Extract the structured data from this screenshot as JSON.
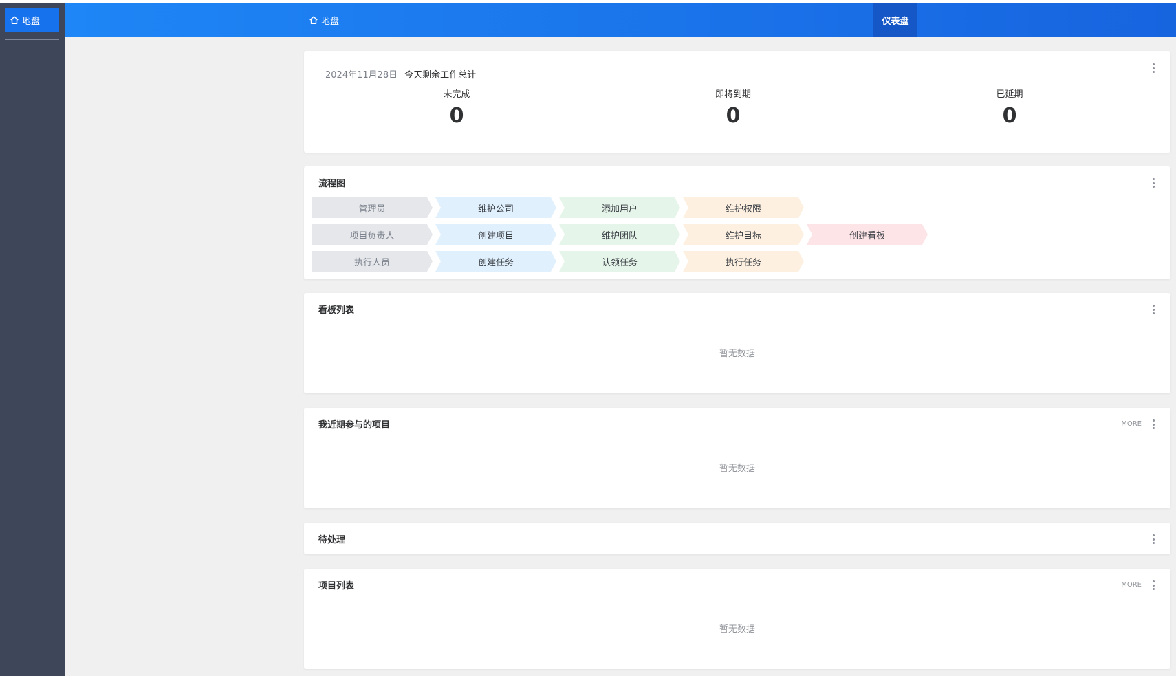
{
  "sidebar": {
    "logo_label": "地盘"
  },
  "header": {
    "breadcrumb": "地盘",
    "active_tab": "仪表盘"
  },
  "summary": {
    "date": "2024年11月28日",
    "title": "今天剩余工作总计",
    "stats": [
      {
        "label": "未完成",
        "value": "0"
      },
      {
        "label": "即将到期",
        "value": "0"
      },
      {
        "label": "已延期",
        "value": "0"
      }
    ]
  },
  "flow": {
    "title": "流程图",
    "rows": [
      {
        "role": "管理员",
        "steps": [
          "维护公司",
          "添加用户",
          "维护权限"
        ]
      },
      {
        "role": "项目负责人",
        "steps": [
          "创建项目",
          "维护团队",
          "维护目标",
          "创建看板"
        ]
      },
      {
        "role": "执行人员",
        "steps": [
          "创建任务",
          "认领任务",
          "执行任务"
        ]
      }
    ]
  },
  "boards": {
    "title": "看板列表",
    "empty": "暂无数据"
  },
  "recent_projects": {
    "title": "我近期参与的项目",
    "more": "MORE",
    "empty": "暂无数据"
  },
  "pending": {
    "title": "待处理"
  },
  "project_list": {
    "title": "项目列表",
    "more": "MORE",
    "empty": "暂无数据"
  }
}
